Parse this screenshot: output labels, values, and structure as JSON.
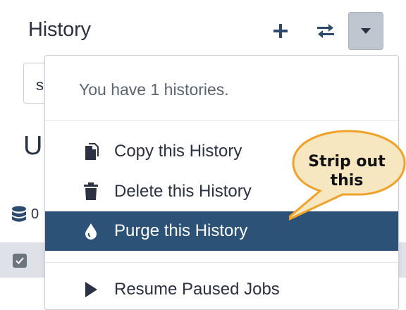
{
  "header": {
    "title": "History",
    "new_icon": "plus-icon",
    "switch_icon": "exchange-icon",
    "options_icon": "caret-down-icon"
  },
  "panel": {
    "search_value": "s",
    "history_name": "U",
    "size": "0"
  },
  "dropdown": {
    "header": "You have 1 histories.",
    "items": [
      {
        "label": "Copy this History",
        "icon": "copy-icon"
      },
      {
        "label": "Delete this History",
        "icon": "trash-icon"
      },
      {
        "label": "Purge this History",
        "icon": "droplet-icon",
        "active": true
      },
      {
        "label": "Resume Paused Jobs",
        "icon": "play-icon"
      }
    ]
  },
  "callout": {
    "text_line1": "Strip out",
    "text_line2": "this",
    "fill_color": "#f7e7c1",
    "border_color": "#f0a12a"
  },
  "colors": {
    "active_item": "#2c5277",
    "accent": "#2c4a6e"
  }
}
